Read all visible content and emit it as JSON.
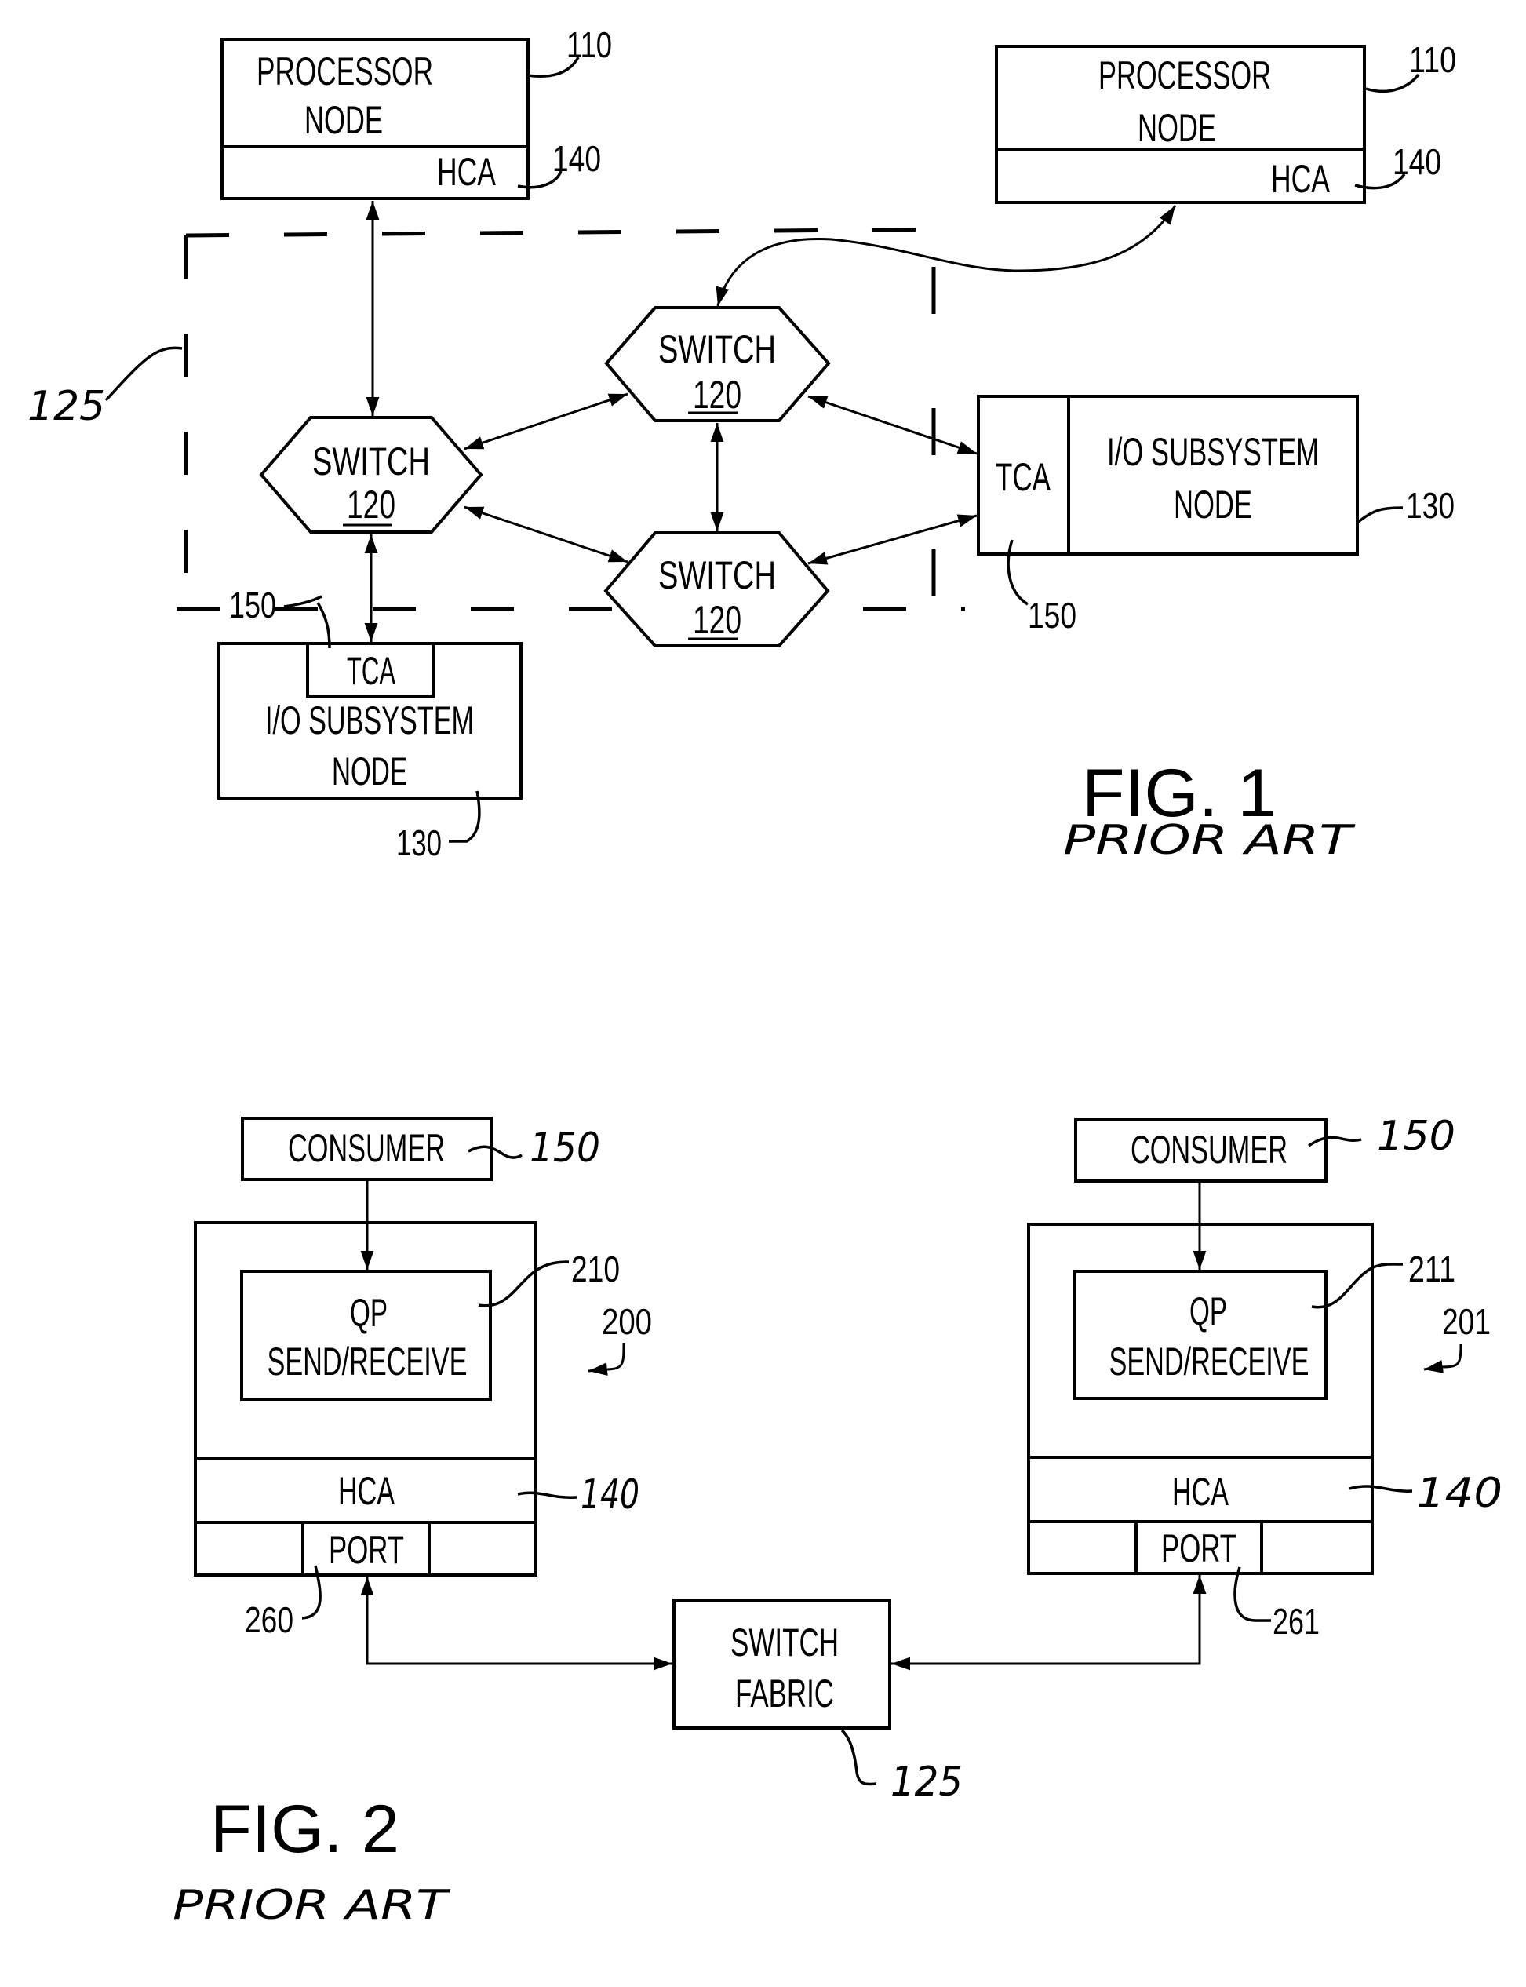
{
  "fig1": {
    "title": "FIG. 1",
    "subtitle": "PRIOR ART",
    "fabric_ref": "125",
    "processor_left": {
      "line1": "PROCESSOR",
      "line2": "NODE",
      "adapter": "HCA",
      "ref": "110",
      "adapter_ref": "140"
    },
    "processor_right": {
      "line1": "PROCESSOR",
      "line2": "NODE",
      "adapter": "HCA",
      "ref": "110",
      "adapter_ref": "140"
    },
    "switch_left": {
      "label": "SWITCH",
      "ref": "120"
    },
    "switch_top": {
      "label": "SWITCH",
      "ref": "120"
    },
    "switch_bottom": {
      "label": "SWITCH",
      "ref": "120"
    },
    "io_right": {
      "line1": "I/O SUBSYSTEM",
      "line2": "NODE",
      "adapter": "TCA",
      "ref": "130",
      "adapter_ref": "150"
    },
    "io_bottom": {
      "line1": "I/O SUBSYSTEM",
      "line2": "NODE",
      "adapter": "TCA",
      "ref": "130",
      "adapter_ref": "150"
    }
  },
  "fig2": {
    "title": "FIG. 2",
    "subtitle": "PRIOR ART",
    "left": {
      "consumer": "CONSUMER",
      "consumer_ref": "150",
      "qp_line1": "QP",
      "qp_line2": "SEND/RECEIVE",
      "qp_ref": "210",
      "host_ref": "200",
      "adapter": "HCA",
      "adapter_ref": "140",
      "port": "PORT",
      "port_ref": "260"
    },
    "right": {
      "consumer": "CONSUMER",
      "consumer_ref": "150",
      "qp_line1": "QP",
      "qp_line2": "SEND/RECEIVE",
      "qp_ref": "211",
      "host_ref": "201",
      "adapter": "HCA",
      "adapter_ref": "140",
      "port": "PORT",
      "port_ref": "261"
    },
    "fabric": {
      "line1": "SWITCH",
      "line2": "FABRIC",
      "ref": "125"
    }
  }
}
